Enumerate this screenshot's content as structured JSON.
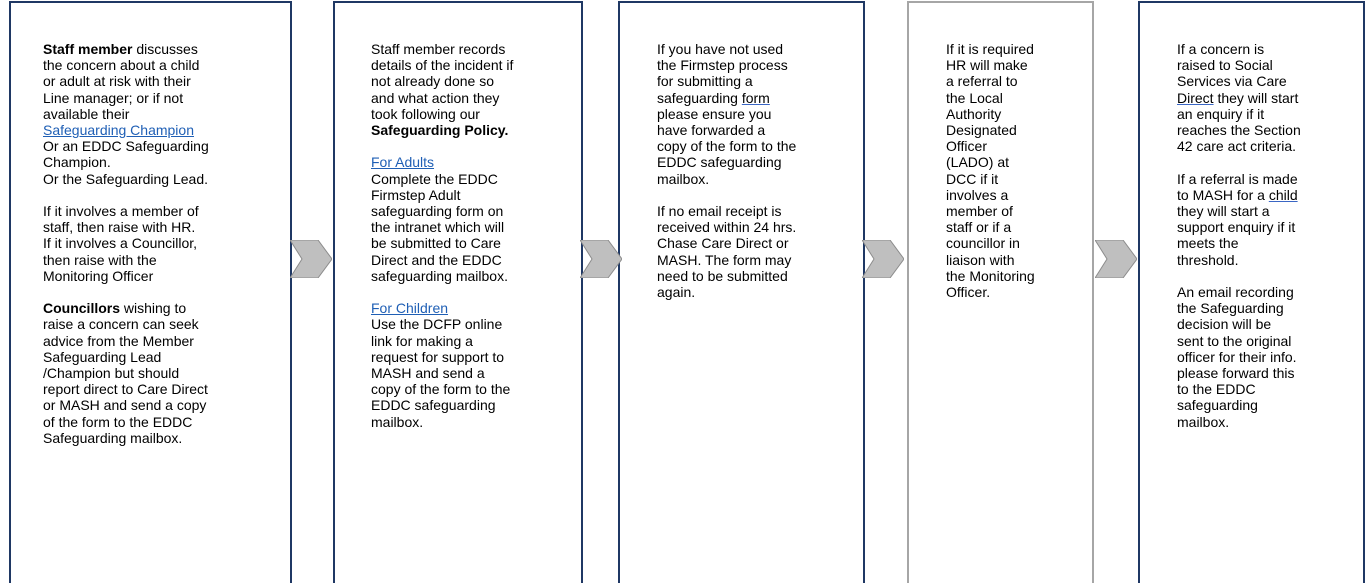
{
  "boxes": [
    {
      "paragraphs": [
        [
          [
            {
              "t": "Staff member",
              "b": true
            },
            {
              "t": " discusses"
            }
          ],
          [
            {
              "t": "the concern about a child"
            }
          ],
          [
            {
              "t": "or adult at risk with their"
            }
          ],
          [
            {
              "t": "Line manager; or if not"
            }
          ],
          [
            {
              "t": "available their"
            }
          ],
          [
            {
              "t": "Safeguarding Champion",
              "link": true
            }
          ],
          [
            {
              "t": "Or an EDDC Safeguarding"
            }
          ],
          [
            {
              "t": "Champion."
            }
          ],
          [
            {
              "t": "Or the Safeguarding Lead."
            }
          ]
        ],
        [
          [
            {
              "t": "If it involves a member of"
            }
          ],
          [
            {
              "t": "staff, then raise with HR."
            }
          ],
          [
            {
              "t": "If it involves a Councillor,"
            }
          ],
          [
            {
              "t": "then raise with the"
            }
          ],
          [
            {
              "t": "Monitoring Officer"
            }
          ]
        ],
        [
          [
            {
              "t": "Councillors",
              "b": true
            },
            {
              "t": " wishing to"
            }
          ],
          [
            {
              "t": "raise a concern can seek"
            }
          ],
          [
            {
              "t": "advice from the Member"
            }
          ],
          [
            {
              "t": "Safeguarding Lead"
            }
          ],
          [
            {
              "t": "/Champion but should"
            }
          ],
          [
            {
              "t": "report direct to Care Direct"
            }
          ],
          [
            {
              "t": "or MASH and send a copy"
            }
          ],
          [
            {
              "t": "of the form to the EDDC"
            }
          ],
          [
            {
              "t": "Safeguarding mailbox."
            }
          ]
        ]
      ]
    },
    {
      "paragraphs": [
        [
          [
            {
              "t": "Staff member records"
            }
          ],
          [
            {
              "t": "details of the incident if"
            }
          ],
          [
            {
              "t": "not already done so"
            }
          ],
          [
            {
              "t": "and what action they"
            }
          ],
          [
            {
              "t": "took following our"
            }
          ],
          [
            {
              "t": "Safeguarding Policy.",
              "b": true
            }
          ]
        ],
        [
          [
            {
              "t": "For Adults",
              "link": true
            }
          ],
          [
            {
              "t": "Complete the EDDC"
            }
          ],
          [
            {
              "t": "Firmstep Adult"
            }
          ],
          [
            {
              "t": "safeguarding form on"
            }
          ],
          [
            {
              "t": "the intranet which will"
            }
          ],
          [
            {
              "t": "be submitted to Care"
            }
          ],
          [
            {
              "t": "Direct and the EDDC"
            }
          ],
          [
            {
              "t": "safeguarding mailbox."
            }
          ]
        ],
        [
          [
            {
              "t": "For Children",
              "link": true
            }
          ],
          [
            {
              "t": "Use the DCFP online"
            }
          ],
          [
            {
              "t": "link for making a"
            }
          ],
          [
            {
              "t": "request for support to"
            }
          ],
          [
            {
              "t": "MASH and send a"
            }
          ],
          [
            {
              "t": "copy of the form to the"
            }
          ],
          [
            {
              "t": "EDDC safeguarding"
            }
          ],
          [
            {
              "t": "mailbox."
            }
          ]
        ]
      ]
    },
    {
      "paragraphs": [
        [
          [
            {
              "t": "If you have not used"
            }
          ],
          [
            {
              "t": "the Firmstep process"
            }
          ],
          [
            {
              "t": "for submitting a"
            }
          ],
          [
            {
              "t": "safeguarding "
            },
            {
              "t": "form",
              "sq": true
            }
          ],
          [
            {
              "t": "please ensure you"
            }
          ],
          [
            {
              "t": "have forwarded a"
            }
          ],
          [
            {
              "t": "copy of the form to the"
            }
          ],
          [
            {
              "t": "EDDC safeguarding"
            }
          ],
          [
            {
              "t": "mailbox."
            }
          ]
        ],
        [
          [
            {
              "t": "If no email receipt is"
            }
          ],
          [
            {
              "t": "received within 24 hrs."
            }
          ],
          [
            {
              "t": "Chase Care Direct or"
            }
          ],
          [
            {
              "t": "MASH. The form may"
            }
          ],
          [
            {
              "t": "need to be submitted"
            }
          ],
          [
            {
              "t": "again."
            }
          ]
        ]
      ]
    },
    {
      "paragraphs": [
        [
          [
            {
              "t": "If it is required"
            }
          ],
          [
            {
              "t": "HR will make"
            }
          ],
          [
            {
              "t": "a referral to"
            }
          ],
          [
            {
              "t": "the Local"
            }
          ],
          [
            {
              "t": "Authority"
            }
          ],
          [
            {
              "t": "Designated"
            }
          ],
          [
            {
              "t": "Officer"
            }
          ],
          [
            {
              "t": "(LADO) at"
            }
          ],
          [
            {
              "t": "DCC if it"
            }
          ],
          [
            {
              "t": "involves a"
            }
          ],
          [
            {
              "t": "member of"
            }
          ],
          [
            {
              "t": "staff or if a"
            }
          ],
          [
            {
              "t": "councillor in"
            }
          ],
          [
            {
              "t": "liaison with"
            }
          ],
          [
            {
              "t": "the Monitoring"
            }
          ],
          [
            {
              "t": "Officer."
            }
          ]
        ]
      ]
    },
    {
      "paragraphs": [
        [
          [
            {
              "t": "If a concern is"
            }
          ],
          [
            {
              "t": "raised to Social"
            }
          ],
          [
            {
              "t": "Services via Care"
            }
          ],
          [
            {
              "t": "Direct",
              "sq": true
            },
            {
              "t": " they will start"
            }
          ],
          [
            {
              "t": "an enquiry if it"
            }
          ],
          [
            {
              "t": "reaches the Section"
            }
          ],
          [
            {
              "t": "42 care act criteria."
            }
          ]
        ],
        [
          [
            {
              "t": "If a referral is made"
            }
          ],
          [
            {
              "t": "to MASH for a "
            },
            {
              "t": "child",
              "sq": true
            }
          ],
          [
            {
              "t": "they will start a"
            }
          ],
          [
            {
              "t": "support enquiry if it"
            }
          ],
          [
            {
              "t": "meets the"
            }
          ],
          [
            {
              "t": "threshold."
            }
          ]
        ],
        [
          [
            {
              "t": "An email recording"
            }
          ],
          [
            {
              "t": "the Safeguarding"
            }
          ],
          [
            {
              "t": "decision will be"
            }
          ],
          [
            {
              "t": "sent to the original"
            }
          ],
          [
            {
              "t": "officer for their info."
            }
          ],
          [
            {
              "t": "please forward this"
            }
          ],
          [
            {
              "t": "to the EDDC"
            }
          ],
          [
            {
              "t": "safeguarding"
            }
          ],
          [
            {
              "t": "mailbox."
            }
          ]
        ]
      ]
    }
  ],
  "colors": {
    "box_border": "#1f3864",
    "box_border_muted": "#a6a6a6",
    "link": "#1f5fb5",
    "arrow_fill": "#bfbfbf",
    "arrow_stroke": "#8c8c8c"
  }
}
